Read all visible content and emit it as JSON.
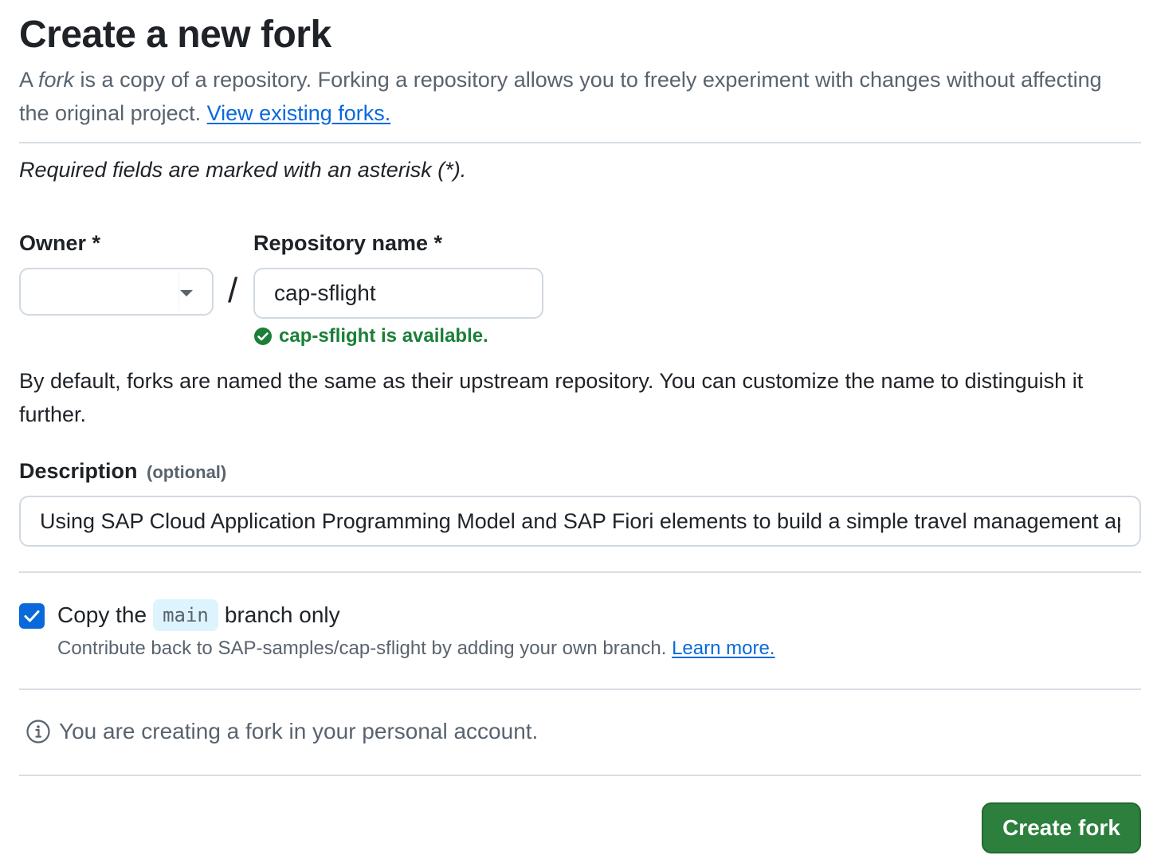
{
  "header": {
    "title": "Create a new fork",
    "subtitle_prefix": "A ",
    "subtitle_em": "fork",
    "subtitle_rest": " is a copy of a repository. Forking a repository allows you to freely experiment with changes without affecting the original project. ",
    "view_forks_link": "View existing forks."
  },
  "form": {
    "required_note": "Required fields are marked with an asterisk (*).",
    "owner": {
      "label": "Owner *",
      "value": ""
    },
    "separator": "/",
    "repository": {
      "label": "Repository name *",
      "value": "cap-sflight",
      "availability": "cap-sflight is available."
    },
    "naming_help": "By default, forks are named the same as their upstream repository. You can customize the name to distinguish it further.",
    "description": {
      "label": "Description",
      "optional_label": "(optional)",
      "value": "Using SAP Cloud Application Programming Model and SAP Fiori elements to build a simple travel management app"
    },
    "copy_branch": {
      "checked": true,
      "label_before": "Copy the",
      "branch": "main",
      "label_after": "branch only",
      "help_text": "Contribute back to SAP-samples/cap-sflight by adding your own branch. ",
      "learn_more": "Learn more."
    },
    "info": "You are creating a fork in your personal account.",
    "submit_label": "Create fork"
  },
  "colors": {
    "link": "#0969da",
    "success": "#1a7f37",
    "primary_button": "#2c7f3c",
    "checkbox": "#0969da",
    "muted_text": "#59636e"
  }
}
